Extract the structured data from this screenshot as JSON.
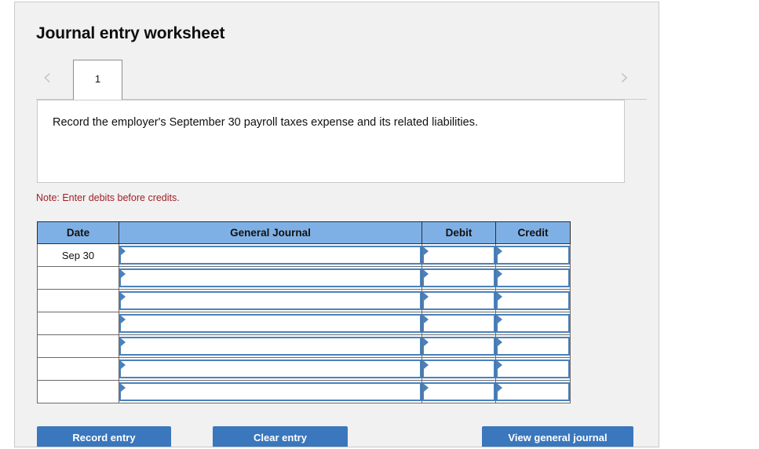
{
  "page": {
    "title": "Journal entry worksheet"
  },
  "tabs": {
    "prev_icon": "chevron-left-icon",
    "prev_glyph": "‹",
    "next_icon": "chevron-right-icon",
    "next_glyph": "›",
    "items": [
      {
        "label": "1",
        "active": true
      }
    ]
  },
  "description": {
    "text": "Record the employer's September 30 payroll taxes expense and its related liabilities."
  },
  "note": {
    "text": "Note: Enter debits before credits."
  },
  "table": {
    "headers": [
      "Date",
      "General Journal",
      "Debit",
      "Credit"
    ],
    "rows": [
      {
        "date": "Sep 30",
        "general_journal": "",
        "debit": "",
        "credit": ""
      },
      {
        "date": "",
        "general_journal": "",
        "debit": "",
        "credit": ""
      },
      {
        "date": "",
        "general_journal": "",
        "debit": "",
        "credit": ""
      },
      {
        "date": "",
        "general_journal": "",
        "debit": "",
        "credit": ""
      },
      {
        "date": "",
        "general_journal": "",
        "debit": "",
        "credit": ""
      },
      {
        "date": "",
        "general_journal": "",
        "debit": "",
        "credit": ""
      },
      {
        "date": "",
        "general_journal": "",
        "debit": "",
        "credit": ""
      }
    ]
  },
  "buttons": {
    "record": "Record entry",
    "clear": "Clear entry",
    "view": "View general journal"
  },
  "colors": {
    "panel_bg": "#f1f1f1",
    "header_blue": "#7fb0e5",
    "button_blue": "#3a77bd",
    "input_border_blue": "#4a81bd",
    "note_red": "#a02128"
  }
}
